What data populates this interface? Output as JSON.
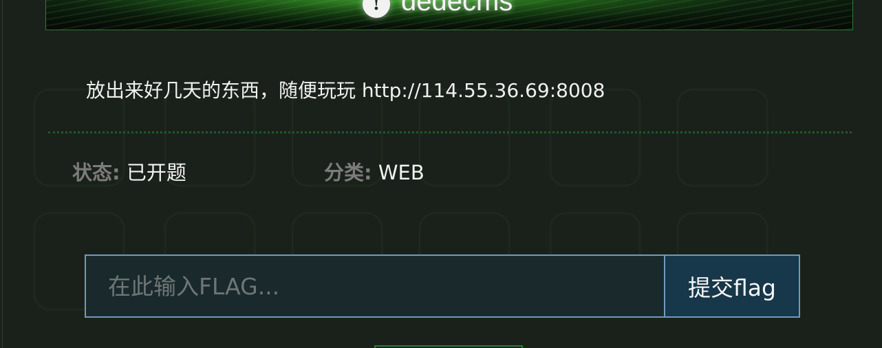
{
  "banner": {
    "title": "dedecms",
    "icon": "info-icon"
  },
  "challenge": {
    "description": "放出来好几天的东西，随便玩玩 http://114.55.36.69:8008",
    "status_label": "状态:",
    "status_value": "已开题",
    "category_label": "分类:",
    "category_value": "WEB"
  },
  "flag_form": {
    "placeholder": "在此输入FLAG...",
    "value": "",
    "submit_label": "提交flag"
  },
  "colors": {
    "background": "#1a211a",
    "accent_green": "#2f7a3a",
    "input_border": "#6f9bbf",
    "submit_bg": "#17384a"
  }
}
